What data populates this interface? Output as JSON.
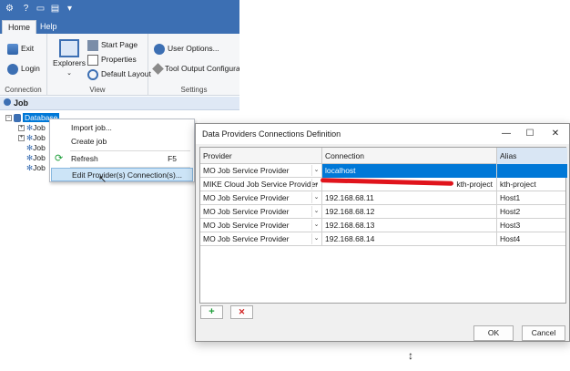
{
  "ribbon": {
    "tabs": [
      "Home",
      "Help"
    ],
    "groups": {
      "connection": {
        "label": "Connection",
        "exit": "Exit",
        "login": "Login"
      },
      "view": {
        "label": "View",
        "explorers": "Explorers",
        "start_page": "Start Page",
        "properties": "Properties",
        "default_layout": "Default Layout"
      },
      "settings": {
        "label": "Settings",
        "user_options": "User Options...",
        "tool_output": "Tool Output Configuration..."
      }
    }
  },
  "job_panel": {
    "title": "Job",
    "tree": {
      "root": "Database",
      "children": [
        "Job",
        "Job",
        "Job",
        "Job",
        "Job"
      ]
    }
  },
  "context_menu": {
    "items": [
      {
        "label": "Import job..."
      },
      {
        "label": "Create job"
      },
      {
        "label": "Refresh",
        "shortcut": "F5"
      },
      {
        "label": "Edit Provider(s) Connection(s)..."
      }
    ]
  },
  "dialog": {
    "title": "Data Providers Connections Definition",
    "columns": [
      "Provider",
      "Connection",
      "Alias"
    ],
    "rows": [
      {
        "provider": "MO Job Service Provider",
        "connection": "localhost",
        "alias": ""
      },
      {
        "provider": "MIKE Cloud Job Service Provider",
        "connection": "kth-project",
        "alias": "kth-project"
      },
      {
        "provider": "MO Job Service Provider",
        "connection": "192.168.68.11",
        "alias": "Host1"
      },
      {
        "provider": "MO Job Service Provider",
        "connection": "192.168.68.12",
        "alias": "Host2"
      },
      {
        "provider": "MO Job Service Provider",
        "connection": "192.168.68.13",
        "alias": "Host3"
      },
      {
        "provider": "MO Job Service Provider",
        "connection": "192.168.68.14",
        "alias": "Host4"
      }
    ],
    "add_symbol": "+",
    "delete_symbol": "✕",
    "ok": "OK",
    "cancel": "Cancel"
  },
  "colors": {
    "accent": "#3c6fb3",
    "selection": "#0078d7",
    "add": "#1e9e3a",
    "delete": "#d01f1f",
    "redaction": "#e0141c"
  }
}
